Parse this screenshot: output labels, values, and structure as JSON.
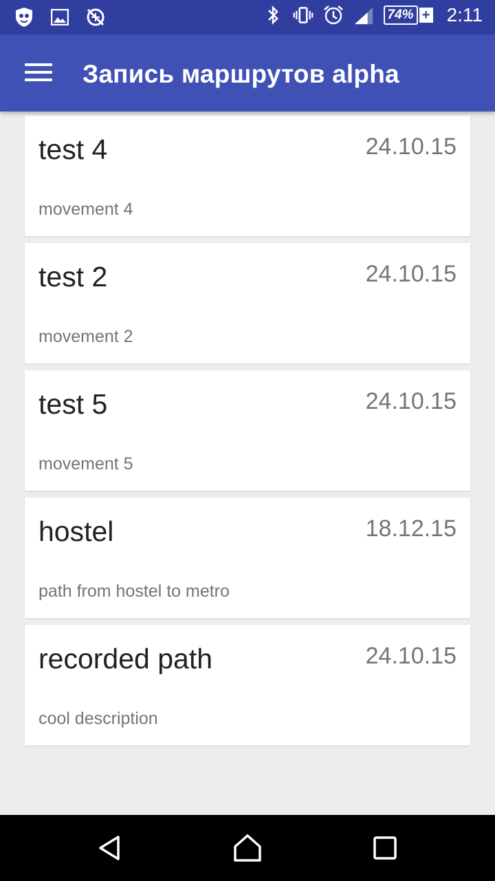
{
  "status_bar": {
    "left_icons": [
      "shield-app-icon",
      "image-icon",
      "no-location-icon"
    ],
    "right_icons": [
      "bluetooth-icon",
      "vibrate-icon",
      "alarm-icon",
      "signal-icon"
    ],
    "battery": "74%",
    "time": "2:11"
  },
  "app_bar": {
    "title": "Запись маршрутов alpha",
    "menu_icon": "hamburger-menu-icon"
  },
  "routes": [
    {
      "title": "test 4",
      "date": "24.10.15",
      "description": "movement 4"
    },
    {
      "title": "test 2",
      "date": "24.10.15",
      "description": "movement 2"
    },
    {
      "title": "test 5",
      "date": "24.10.15",
      "description": "movement 5"
    },
    {
      "title": "hostel",
      "date": "18.12.15",
      "description": "path from hostel to metro"
    },
    {
      "title": "recorded path",
      "date": "24.10.15",
      "description": "cool description"
    }
  ],
  "nav_bar": {
    "buttons": [
      "back-icon",
      "home-icon",
      "recents-icon"
    ]
  },
  "colors": {
    "primary": "#3f51b5",
    "primary_dark": "#303f9f",
    "background": "#ededed"
  }
}
